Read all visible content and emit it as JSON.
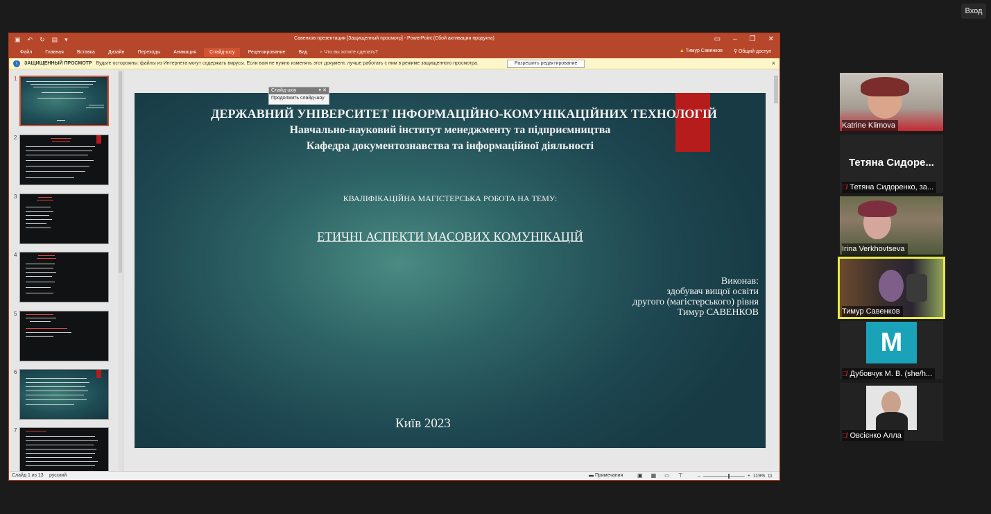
{
  "zoom": {
    "enter_label": "Вход"
  },
  "ppt": {
    "title": "Савенков презентация [Защищенный просмотр] - PowerPoint (Сбой активации продукта)",
    "tabs": [
      "Файл",
      "Главная",
      "Вставка",
      "Дизайн",
      "Переходы",
      "Анимация",
      "Слайд-шоу",
      "Рецензирование",
      "Вид"
    ],
    "active_tab": "Слайд-шоу",
    "tell_me": "Что вы хотите сделать?",
    "user": "Тимур Савенков",
    "share": "Общий доступ",
    "warning": {
      "label": "ЗАЩИЩЕННЫЙ ПРОСМОТР",
      "text": "Будьте осторожны: файлы из Интернета могут содержать вирусы. Если вам не нужно изменять этот документ, лучше работать с ним в режиме защищенного просмотра.",
      "button": "Разрешить редактирование"
    },
    "thumbnails": [
      "1",
      "2",
      "3",
      "4",
      "5",
      "6",
      "7"
    ],
    "slideshow_popup": {
      "header": "Слайд-шоу",
      "item": "Продолжить слайд-шоу"
    },
    "slide": {
      "line1": "ДЕРЖАВНИЙ УНІВЕРСИТЕТ ІНФОРМАЦІЙНО-КОМУНІКАЦІЙНИХ ТЕХНОЛОГІЙ",
      "line2": "Навчально-науковий інститут менеджменту та підприємництва",
      "line3": "Кафедра документознавства та інформаційної діяльності",
      "subtitle": "КВАЛІФІКАЦІЙНА МАГІСТЕРСЬКА РОБОТА НА ТЕМУ:",
      "topic": "ЕТИЧНІ АСПЕКТИ МАСОВИХ КОМУНІКАЦІЙ",
      "author": [
        "Виконав:",
        "здобувач вищої освіти",
        "другого (магістерського) рівня",
        "Тимур САВЕНКОВ"
      ],
      "city_year": "Київ 2023"
    },
    "status": {
      "slide_of": "Слайд 1 из 13",
      "language": "русский",
      "notes": "Примечания",
      "zoom": "119%"
    }
  },
  "participants": [
    {
      "name": "Katrine Klimova",
      "muted": false
    },
    {
      "name": "Тетяна Сидоренко, за...",
      "display": "Тетяна Сидоре...",
      "muted": true
    },
    {
      "name": "Irina Verkhovtseva",
      "muted": false
    },
    {
      "name": "Тимур Савенков",
      "muted": false,
      "speaking": true
    },
    {
      "name": "Дубовчук М. В. (she/h...",
      "initial": "M",
      "muted": true
    },
    {
      "name": "Овсієнко Алла",
      "muted": true
    }
  ],
  "colors": {
    "ppt_accent": "#b7472a",
    "slide_accent": "#b71c1c",
    "speaker_border": "#e6e84a"
  }
}
